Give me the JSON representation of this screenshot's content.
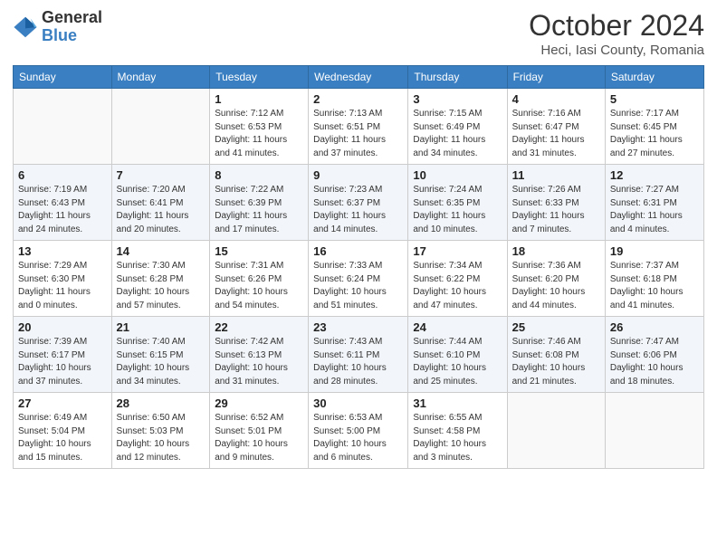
{
  "header": {
    "logo_general": "General",
    "logo_blue": "Blue",
    "month_title": "October 2024",
    "location": "Heci, Iasi County, Romania"
  },
  "days_of_week": [
    "Sunday",
    "Monday",
    "Tuesday",
    "Wednesday",
    "Thursday",
    "Friday",
    "Saturday"
  ],
  "weeks": [
    [
      {
        "day": "",
        "info": ""
      },
      {
        "day": "",
        "info": ""
      },
      {
        "day": "1",
        "info": "Sunrise: 7:12 AM\nSunset: 6:53 PM\nDaylight: 11 hours and 41 minutes."
      },
      {
        "day": "2",
        "info": "Sunrise: 7:13 AM\nSunset: 6:51 PM\nDaylight: 11 hours and 37 minutes."
      },
      {
        "day": "3",
        "info": "Sunrise: 7:15 AM\nSunset: 6:49 PM\nDaylight: 11 hours and 34 minutes."
      },
      {
        "day": "4",
        "info": "Sunrise: 7:16 AM\nSunset: 6:47 PM\nDaylight: 11 hours and 31 minutes."
      },
      {
        "day": "5",
        "info": "Sunrise: 7:17 AM\nSunset: 6:45 PM\nDaylight: 11 hours and 27 minutes."
      }
    ],
    [
      {
        "day": "6",
        "info": "Sunrise: 7:19 AM\nSunset: 6:43 PM\nDaylight: 11 hours and 24 minutes."
      },
      {
        "day": "7",
        "info": "Sunrise: 7:20 AM\nSunset: 6:41 PM\nDaylight: 11 hours and 20 minutes."
      },
      {
        "day": "8",
        "info": "Sunrise: 7:22 AM\nSunset: 6:39 PM\nDaylight: 11 hours and 17 minutes."
      },
      {
        "day": "9",
        "info": "Sunrise: 7:23 AM\nSunset: 6:37 PM\nDaylight: 11 hours and 14 minutes."
      },
      {
        "day": "10",
        "info": "Sunrise: 7:24 AM\nSunset: 6:35 PM\nDaylight: 11 hours and 10 minutes."
      },
      {
        "day": "11",
        "info": "Sunrise: 7:26 AM\nSunset: 6:33 PM\nDaylight: 11 hours and 7 minutes."
      },
      {
        "day": "12",
        "info": "Sunrise: 7:27 AM\nSunset: 6:31 PM\nDaylight: 11 hours and 4 minutes."
      }
    ],
    [
      {
        "day": "13",
        "info": "Sunrise: 7:29 AM\nSunset: 6:30 PM\nDaylight: 11 hours and 0 minutes."
      },
      {
        "day": "14",
        "info": "Sunrise: 7:30 AM\nSunset: 6:28 PM\nDaylight: 10 hours and 57 minutes."
      },
      {
        "day": "15",
        "info": "Sunrise: 7:31 AM\nSunset: 6:26 PM\nDaylight: 10 hours and 54 minutes."
      },
      {
        "day": "16",
        "info": "Sunrise: 7:33 AM\nSunset: 6:24 PM\nDaylight: 10 hours and 51 minutes."
      },
      {
        "day": "17",
        "info": "Sunrise: 7:34 AM\nSunset: 6:22 PM\nDaylight: 10 hours and 47 minutes."
      },
      {
        "day": "18",
        "info": "Sunrise: 7:36 AM\nSunset: 6:20 PM\nDaylight: 10 hours and 44 minutes."
      },
      {
        "day": "19",
        "info": "Sunrise: 7:37 AM\nSunset: 6:18 PM\nDaylight: 10 hours and 41 minutes."
      }
    ],
    [
      {
        "day": "20",
        "info": "Sunrise: 7:39 AM\nSunset: 6:17 PM\nDaylight: 10 hours and 37 minutes."
      },
      {
        "day": "21",
        "info": "Sunrise: 7:40 AM\nSunset: 6:15 PM\nDaylight: 10 hours and 34 minutes."
      },
      {
        "day": "22",
        "info": "Sunrise: 7:42 AM\nSunset: 6:13 PM\nDaylight: 10 hours and 31 minutes."
      },
      {
        "day": "23",
        "info": "Sunrise: 7:43 AM\nSunset: 6:11 PM\nDaylight: 10 hours and 28 minutes."
      },
      {
        "day": "24",
        "info": "Sunrise: 7:44 AM\nSunset: 6:10 PM\nDaylight: 10 hours and 25 minutes."
      },
      {
        "day": "25",
        "info": "Sunrise: 7:46 AM\nSunset: 6:08 PM\nDaylight: 10 hours and 21 minutes."
      },
      {
        "day": "26",
        "info": "Sunrise: 7:47 AM\nSunset: 6:06 PM\nDaylight: 10 hours and 18 minutes."
      }
    ],
    [
      {
        "day": "27",
        "info": "Sunrise: 6:49 AM\nSunset: 5:04 PM\nDaylight: 10 hours and 15 minutes."
      },
      {
        "day": "28",
        "info": "Sunrise: 6:50 AM\nSunset: 5:03 PM\nDaylight: 10 hours and 12 minutes."
      },
      {
        "day": "29",
        "info": "Sunrise: 6:52 AM\nSunset: 5:01 PM\nDaylight: 10 hours and 9 minutes."
      },
      {
        "day": "30",
        "info": "Sunrise: 6:53 AM\nSunset: 5:00 PM\nDaylight: 10 hours and 6 minutes."
      },
      {
        "day": "31",
        "info": "Sunrise: 6:55 AM\nSunset: 4:58 PM\nDaylight: 10 hours and 3 minutes."
      },
      {
        "day": "",
        "info": ""
      },
      {
        "day": "",
        "info": ""
      }
    ]
  ]
}
